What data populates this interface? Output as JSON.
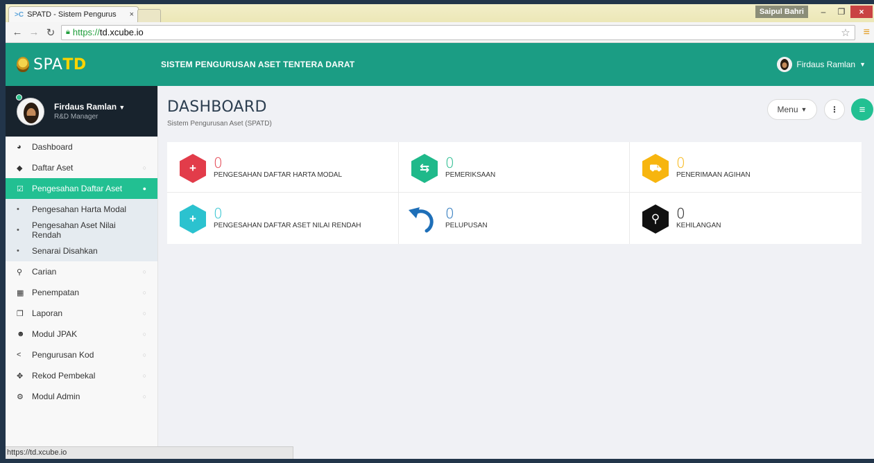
{
  "browser": {
    "tab_title": "SPATD - Sistem Pengurus",
    "tab_close": "×",
    "os_user": "Saipul Bahri",
    "url_scheme": "https://",
    "url_host": "td.xcube.io",
    "status_url": "https://td.xcube.io"
  },
  "header": {
    "logo_prefix": "SPA",
    "logo_accent": "TD",
    "system_title": "SISTEM PENGURUSAN ASET TENTERA DARAT",
    "user_name": "Firdaus Ramlan"
  },
  "profile": {
    "name": "Firdaus Ramlan",
    "role": "R&D Manager"
  },
  "sidebar": {
    "items": [
      {
        "label": "Dashboard",
        "icon": "dashboard-icon",
        "glyph": "◕"
      },
      {
        "label": "Daftar Aset",
        "icon": "tag-icon",
        "glyph": "◆"
      },
      {
        "label": "Pengesahan Daftar Aset",
        "icon": "checkbox-icon",
        "glyph": "☑"
      },
      {
        "label": "Pengesahan Harta Modal",
        "icon": "bullet-icon",
        "glyph": "•"
      },
      {
        "label": "Pengesahan Aset Nilai Rendah",
        "icon": "bullet-icon",
        "glyph": "•"
      },
      {
        "label": "Senarai Disahkan",
        "icon": "bullet-icon",
        "glyph": "•"
      },
      {
        "label": "Carian",
        "icon": "search-icon",
        "glyph": "⚲"
      },
      {
        "label": "Penempatan",
        "icon": "building-icon",
        "glyph": "▦"
      },
      {
        "label": "Laporan",
        "icon": "copy-icon",
        "glyph": "❐"
      },
      {
        "label": "Modul JPAK",
        "icon": "users-icon",
        "glyph": "☻"
      },
      {
        "label": "Pengurusan Kod",
        "icon": "share-icon",
        "glyph": "<"
      },
      {
        "label": "Rekod Pembekal",
        "icon": "handshake-icon",
        "glyph": "✥"
      },
      {
        "label": "Modul Admin",
        "icon": "cogs-icon",
        "glyph": "⚙"
      }
    ]
  },
  "page": {
    "title": "DASHBOARD",
    "subtitle": "Sistem Pengurusan Aset (SPATD)",
    "menu_label": "Menu"
  },
  "stats": [
    {
      "value": "0",
      "label": "PENGESAHAN DAFTAR HARTA MODAL",
      "color": "#e23c4a",
      "icon": "plus-icon",
      "glyph": "+"
    },
    {
      "value": "0",
      "label": "PEMERIKSAAN",
      "color": "#1fb98a",
      "icon": "transfer-icon",
      "glyph": "⇆"
    },
    {
      "value": "0",
      "label": "PENERIMAAN AGIHAN",
      "color": "#f7b50f",
      "icon": "cart-icon",
      "glyph": "⛟"
    },
    {
      "value": "0",
      "label": "PENGESAHAN DAFTAR ASET NILAI RENDAH",
      "color": "#2bc2cf",
      "icon": "plus-icon",
      "glyph": "+"
    },
    {
      "value": "0",
      "label": "PELUPUSAN",
      "color": "#1e6fb8",
      "icon": "undo-icon",
      "glyph": ""
    },
    {
      "value": "0",
      "label": "KEHILANGAN",
      "color": "#111111",
      "icon": "search-icon",
      "glyph": "⚲"
    }
  ]
}
